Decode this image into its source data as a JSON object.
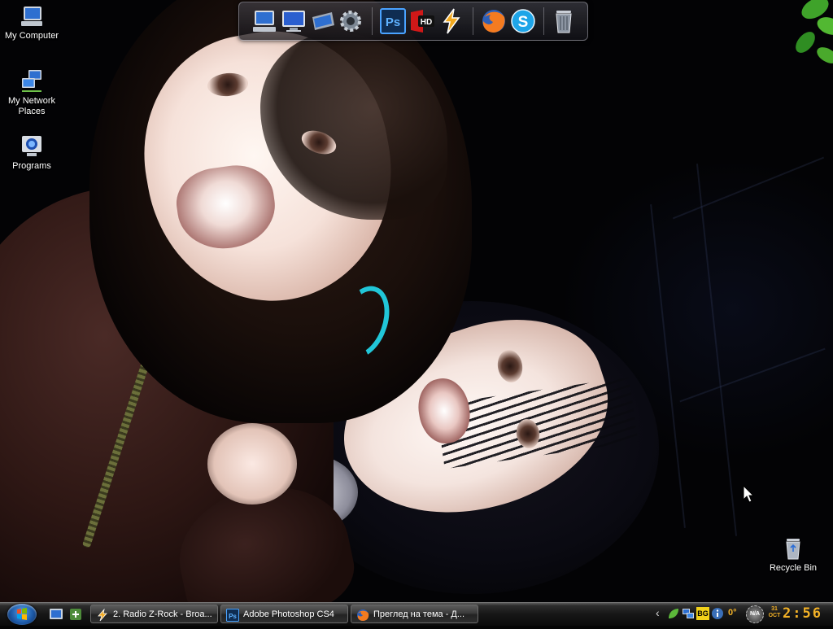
{
  "desktop": {
    "icons": [
      {
        "label": "My Computer",
        "icon": "my-computer-icon"
      },
      {
        "label": "My Network Places",
        "icon": "network-places-icon"
      },
      {
        "label": "Programs",
        "icon": "programs-icon"
      },
      {
        "label": "Recycle Bin",
        "icon": "recycle-bin-icon"
      }
    ],
    "wallpaper": "photo of two laughing girls at night"
  },
  "dock": {
    "items": [
      {
        "icon": "my-computer-icon"
      },
      {
        "icon": "monitor-icon"
      },
      {
        "icon": "folder-icon"
      },
      {
        "icon": "settings-gear-icon"
      },
      {
        "icon": "photoshop-icon",
        "text": "Ps"
      },
      {
        "icon": "hd-video-icon",
        "text": "HD"
      },
      {
        "icon": "winamp-icon"
      },
      {
        "icon": "firefox-icon"
      },
      {
        "icon": "skype-icon",
        "text": "S"
      },
      {
        "icon": "trash-icon"
      }
    ]
  },
  "taskbar": {
    "start_icon": "windows-start-orb-icon",
    "quick_launch": [
      {
        "icon": "show-desktop-icon"
      },
      {
        "icon": "quick-launch-icon"
      }
    ],
    "tasks": [
      {
        "label": "2. Radio Z-Rock - Broa...",
        "icon": "winamp-icon"
      },
      {
        "label": "Adobe Photoshop CS4",
        "icon": "photoshop-icon"
      },
      {
        "label": "Преглед на тема - Д...",
        "icon": "firefox-icon"
      }
    ],
    "tray": {
      "expand": "‹",
      "icons": [
        "leaf-icon",
        "network-icon",
        "bg-keyboard-icon",
        "info-icon"
      ],
      "bg_label": "BG",
      "temperature": "0°",
      "status_badge": "N/A",
      "date_day": "31",
      "date_month": "OCT",
      "time": "2:56"
    }
  },
  "colors": {
    "clock": "#f3b227",
    "taskbar": "#161616",
    "accent_cyan": "#21c6d8"
  }
}
